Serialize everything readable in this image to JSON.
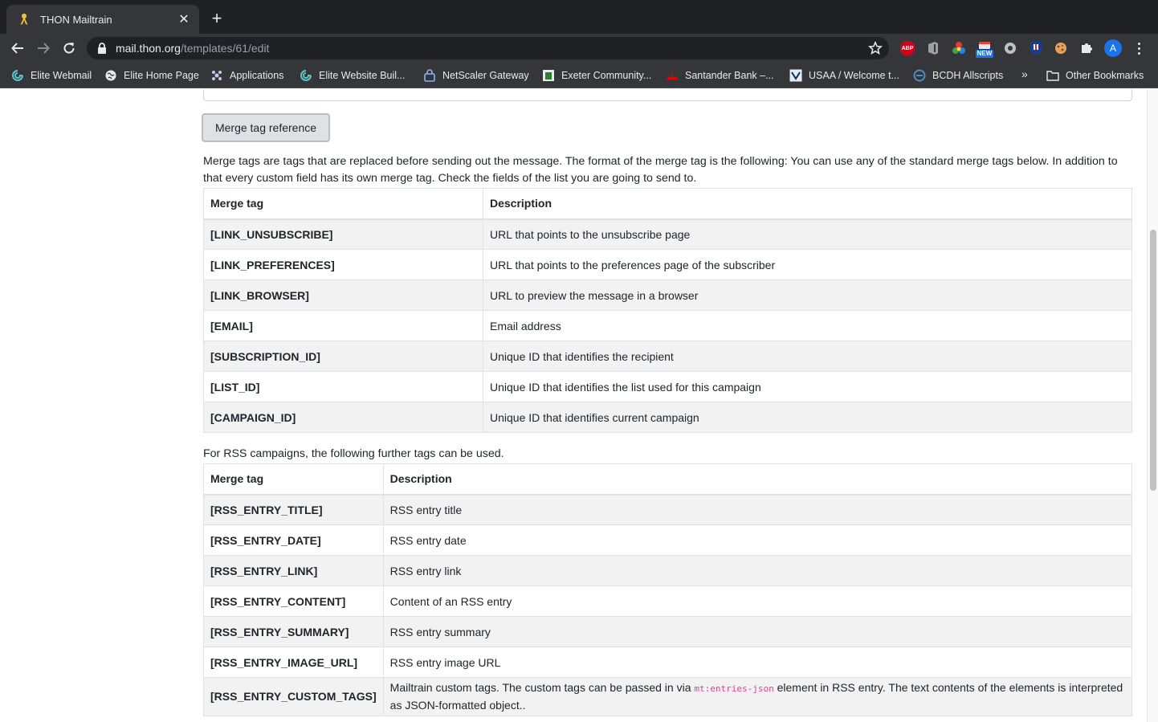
{
  "browser": {
    "tab_title": "THON Mailtrain",
    "url_host": "mail.thon.org",
    "url_path": "/templates/61/edit",
    "avatar_letter": "A",
    "ext_new_badge": "NEW",
    "ext_abp_label": "ABP",
    "bookmarks": [
      {
        "label": "Elite Webmail",
        "icon": "elite-webmail-icon"
      },
      {
        "label": "Elite Home Page",
        "icon": "globe-icon"
      },
      {
        "label": "Applications",
        "icon": "applications-icon"
      },
      {
        "label": "Elite Website Buil...",
        "icon": "elite-website-icon"
      },
      {
        "label": "NetScaler Gateway",
        "icon": "netscaler-icon"
      },
      {
        "label": "Exeter Community...",
        "icon": "exeter-icon"
      },
      {
        "label": "Santander Bank –...",
        "icon": "santander-icon"
      },
      {
        "label": "USAA / Welcome t...",
        "icon": "usaa-icon"
      },
      {
        "label": "BCDH Allscripts",
        "icon": "bcdh-icon"
      }
    ],
    "bookmarks_more": "»",
    "other_bookmarks": "Other Bookmarks"
  },
  "page": {
    "merge_button_label": "Merge tag reference",
    "intro_text": "Merge tags are tags that are replaced before sending out the message. The format of the merge tag is the following: You can use any of the standard merge tags below. In addition to that every custom field has its own merge tag. Check the fields of the list you are going to send to.",
    "table1": {
      "headers": [
        "Merge tag",
        "Description"
      ],
      "rows": [
        {
          "tag": "[LINK_UNSUBSCRIBE]",
          "desc": "URL that points to the unsubscribe page"
        },
        {
          "tag": "[LINK_PREFERENCES]",
          "desc": "URL that points to the preferences page of the subscriber"
        },
        {
          "tag": "[LINK_BROWSER]",
          "desc": "URL to preview the message in a browser"
        },
        {
          "tag": "[EMAIL]",
          "desc": "Email address"
        },
        {
          "tag": "[SUBSCRIPTION_ID]",
          "desc": "Unique ID that identifies the recipient"
        },
        {
          "tag": "[LIST_ID]",
          "desc": "Unique ID that identifies the list used for this campaign"
        },
        {
          "tag": "[CAMPAIGN_ID]",
          "desc": "Unique ID that identifies current campaign"
        }
      ]
    },
    "rss_text": "For RSS campaigns, the following further tags can be used.",
    "table2": {
      "headers": [
        "Merge tag",
        "Description"
      ],
      "rows": [
        {
          "tag": "[RSS_ENTRY_TITLE]",
          "desc": "RSS entry title"
        },
        {
          "tag": "[RSS_ENTRY_DATE]",
          "desc": "RSS entry date"
        },
        {
          "tag": "[RSS_ENTRY_LINK]",
          "desc": "RSS entry link"
        },
        {
          "tag": "[RSS_ENTRY_CONTENT]",
          "desc": "Content of an RSS entry"
        },
        {
          "tag": "[RSS_ENTRY_SUMMARY]",
          "desc": "RSS entry summary"
        },
        {
          "tag": "[RSS_ENTRY_IMAGE_URL]",
          "desc": "RSS entry image URL"
        }
      ],
      "custom_tags_row": {
        "tag": "[RSS_ENTRY_CUSTOM_TAGS]",
        "desc_before": "Mailtrain custom tags. The custom tags can be passed in via ",
        "desc_code": "mt:entries-json",
        "desc_after": " element in RSS entry. The text contents of the elements is interpreted as JSON-formatted object.."
      }
    }
  }
}
